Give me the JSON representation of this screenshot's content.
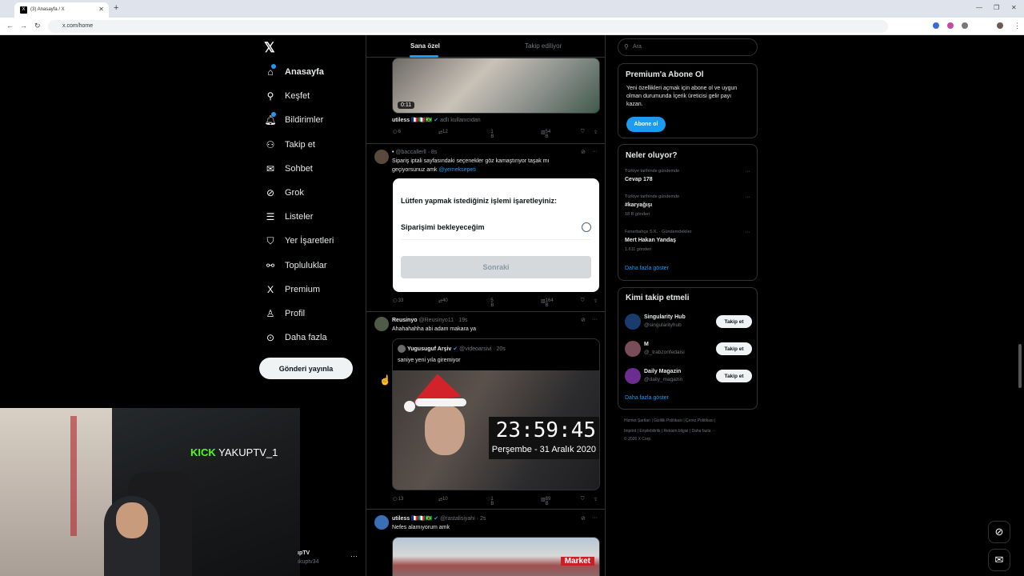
{
  "browser": {
    "tab_title": "(3) Anasayfa / X",
    "favicon": "X",
    "url": "x.com/home"
  },
  "nav": {
    "items": [
      {
        "label": "Anasayfa",
        "icon": "home-icon",
        "glyph": "⌂"
      },
      {
        "label": "Keşfet",
        "icon": "search-icon",
        "glyph": "⚲"
      },
      {
        "label": "Bildirimler",
        "icon": "bell-icon",
        "glyph": "🔔︎"
      },
      {
        "label": "Takip et",
        "icon": "add-person-icon",
        "glyph": "⚇"
      },
      {
        "label": "Sohbet",
        "icon": "mail-icon",
        "glyph": "✉"
      },
      {
        "label": "Grok",
        "icon": "grok-icon",
        "glyph": "⊘"
      },
      {
        "label": "Listeler",
        "icon": "list-icon",
        "glyph": "☰"
      },
      {
        "label": "Yer İşaretleri",
        "icon": "bookmark-icon",
        "glyph": "⛉"
      },
      {
        "label": "Topluluklar",
        "icon": "communities-icon",
        "glyph": "⚯"
      },
      {
        "label": "Premium",
        "icon": "x-logo-icon",
        "glyph": "X"
      },
      {
        "label": "Profil",
        "icon": "profile-icon",
        "glyph": "♙"
      },
      {
        "label": "Daha fazla",
        "icon": "more-circle-icon",
        "glyph": "⊙"
      }
    ],
    "post_button": "Gönderi yayınla",
    "notification_count": "3"
  },
  "feed": {
    "tabs": [
      "Sana özel",
      "Takip ediliyor"
    ],
    "tweet1": {
      "duration": "0:11",
      "author": "utiless",
      "flags": "🇫🇷🇮🇹🇧🇷",
      "source": "adlı kullanıcıdan",
      "replies": "6",
      "retweets": "12",
      "likes": "1 B",
      "views": "54 B"
    },
    "tweet2": {
      "author": "•",
      "handle": "@baccallerll · 8s",
      "text": "Sipariş iptali sayfasındaki seçenekler göz kamaştırıyor taşak mı geçiyorsunuz amk",
      "mention": "@yemeksepeti",
      "card_title": "Lütfen yapmak istediğiniz işlemi işaretleyiniz:",
      "card_option": "Siparişimi bekleyeceğim",
      "card_button": "Sonraki",
      "replies": "33",
      "retweets": "40",
      "likes": "5 B",
      "views": "164 B"
    },
    "tweet3": {
      "author": "Reusinyo",
      "handle": "@Reusinyo11 · 19s",
      "text": "Ahahahahha abi adam makara ya",
      "quote_author": "Yugusuguf Arşiv",
      "quote_handle": "@videoarsivi · 20s",
      "quote_text": "saniye yeni yıla giremiyor",
      "clock": "23:59:45",
      "date": "Perşembe - 31 Aralık 2020",
      "replies": "13",
      "retweets": "10",
      "likes": "1 B",
      "views": "89 B"
    },
    "tweet4": {
      "author": "utiless",
      "flags": "🇫🇷🇮🇹🇧🇷",
      "handle": "@rastalisiyahi · 2s",
      "text": "Nefes alamıyorum amk",
      "market": "Market"
    }
  },
  "right": {
    "search_placeholder": "Ara",
    "premium": {
      "title": "Premium'a Abone Ol",
      "text1": "Yeni özellikleri açmak için abone ol ve uygun",
      "text2": "olman durumunda İçerik üreticisi gelir payı",
      "text3": "kazan.",
      "button": "Abone ol"
    },
    "trends": {
      "title": "Neler oluyor?",
      "items": [
        {
          "meta": "Türkiye tarihinde gündemde",
          "name": "Cevap 178",
          "count": ""
        },
        {
          "meta": "Türkiye tarihinde gündemde",
          "name": "#karyağışı",
          "count": "18 B gönderi"
        },
        {
          "meta": "Fenerbahçe S.K. · Gündemdekiler",
          "name": "Mert Hakan Yandaş",
          "count": "1.611 gönderi"
        }
      ],
      "show_more": "Daha fazla göster"
    },
    "who_to_follow": {
      "title": "Kimi takip etmeli",
      "items": [
        {
          "name": "Singularity Hub",
          "handle": "@singularityhub",
          "button": "Takip et",
          "color": "#1a3b6e"
        },
        {
          "name": "M",
          "handle": "@_trabzonfedaisi",
          "button": "Takip et",
          "color": "#7a4c5a"
        },
        {
          "name": "Daily Magazin",
          "handle": "@daily_magazin",
          "button": "Takip et",
          "color": "#6b2d8f"
        }
      ],
      "show_more": "Daha fazla göster"
    },
    "footer": {
      "line1": "Hizmet Şartları  |  Gizlilik Politikası  |  Çerez Politikası  |",
      "line2": "Imprint  |  Erişilebilirlik  |  Reklam bilgisi  |  Daha fazla ···",
      "line3": "© 2026 X Corp."
    }
  },
  "stream": {
    "kick_logo": "KICK",
    "kick_name": "YAKUPTV_1",
    "profile_name": "ıpTV",
    "profile_handle": "ıkuptv34"
  }
}
